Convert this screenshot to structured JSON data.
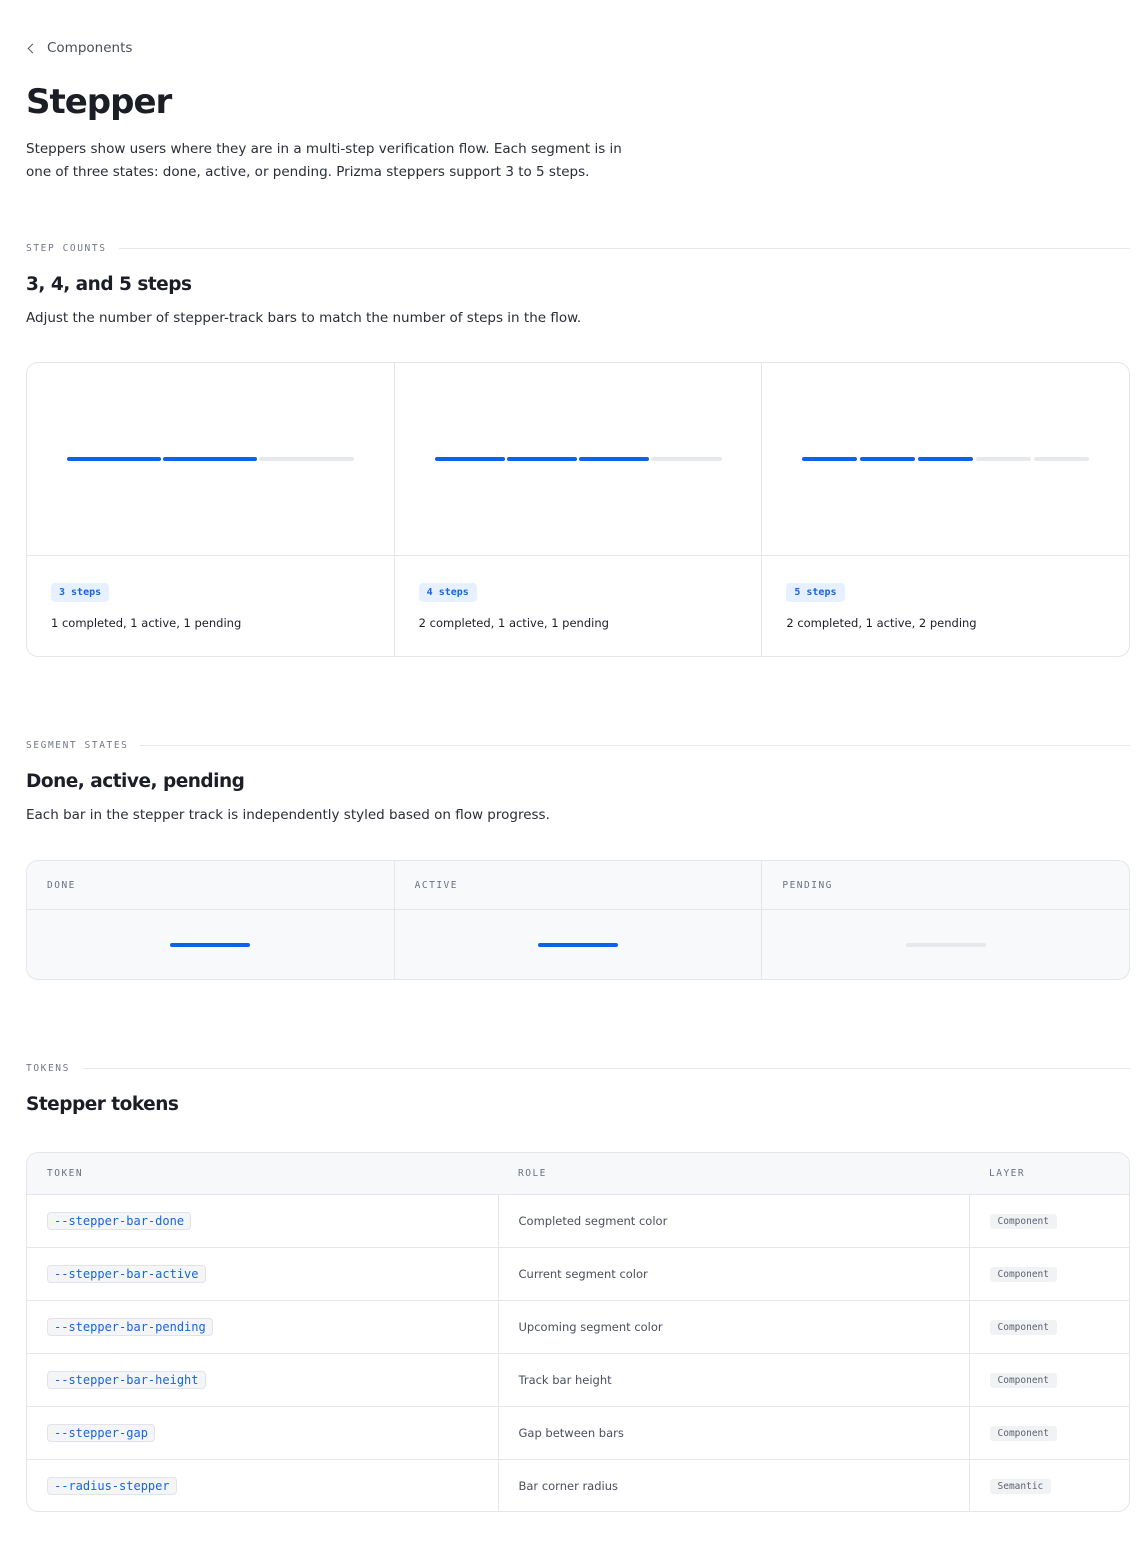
{
  "nav": {
    "back_label": "Components"
  },
  "page": {
    "title": "Stepper",
    "intro": "Steppers show users where they are in a multi-step verification flow. Each segment is in one of three states: done, active, or pending. Prizma steppers support 3 to 5 steps."
  },
  "colors": {
    "accent": "#0a63ea",
    "pending": "#e7e8ec",
    "badge_bg": "#e6f0fe"
  },
  "step_counts": {
    "section_label": "STEP COUNTS",
    "heading": "3, 4, and 5 steps",
    "description": "Adjust the number of stepper-track bars to match the number of steps in the flow.",
    "examples": [
      {
        "badge": "3 steps",
        "summary": "1 completed, 1 active, 1 pending",
        "bars": [
          "done",
          "active",
          "pending"
        ]
      },
      {
        "badge": "4 steps",
        "summary": "2 completed, 1 active, 1 pending",
        "bars": [
          "done",
          "done",
          "active",
          "pending"
        ]
      },
      {
        "badge": "5 steps",
        "summary": "2 completed, 1 active, 2 pending",
        "bars": [
          "done",
          "done",
          "active",
          "pending",
          "pending"
        ]
      }
    ]
  },
  "segment_states": {
    "section_label": "SEGMENT STATES",
    "heading": "Done, active, pending",
    "description": "Each bar in the stepper track is independently styled based on flow progress.",
    "states": [
      {
        "label": "DONE",
        "state": "done"
      },
      {
        "label": "ACTIVE",
        "state": "active"
      },
      {
        "label": "PENDING",
        "state": "pending"
      }
    ]
  },
  "tokens": {
    "section_label": "TOKENS",
    "heading": "Stepper tokens",
    "columns": [
      "TOKEN",
      "ROLE",
      "LAYER"
    ],
    "rows": [
      {
        "token": "--stepper-bar-done",
        "role": "Completed segment color",
        "layer": "Component"
      },
      {
        "token": "--stepper-bar-active",
        "role": "Current segment color",
        "layer": "Component"
      },
      {
        "token": "--stepper-bar-pending",
        "role": "Upcoming segment color",
        "layer": "Component"
      },
      {
        "token": "--stepper-bar-height",
        "role": "Track bar height",
        "layer": "Component"
      },
      {
        "token": "--stepper-gap",
        "role": "Gap between bars",
        "layer": "Component"
      },
      {
        "token": "--radius-stepper",
        "role": "Bar corner radius",
        "layer": "Semantic"
      }
    ]
  }
}
